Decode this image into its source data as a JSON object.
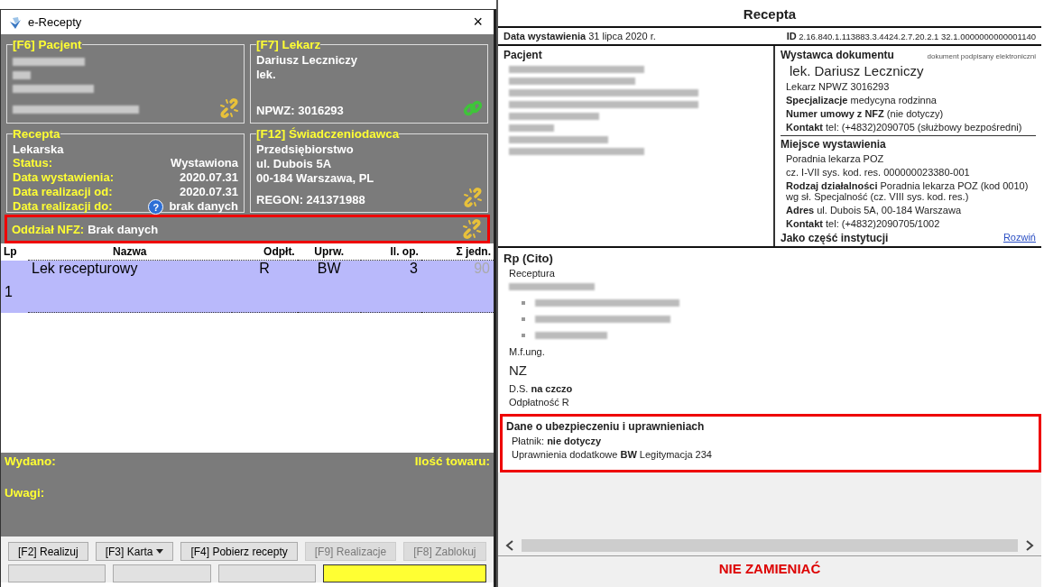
{
  "window": {
    "title": "e-Recepty",
    "close": "×"
  },
  "patient": {
    "legend": "[F6] Pacjent",
    "linked": false
  },
  "doctor": {
    "legend": "[F7] Lekarz",
    "lines": [
      "Dariusz Leczniczy",
      "lek."
    ],
    "npwz": "NPWZ: 3016293",
    "linked": true
  },
  "prescription": {
    "legend": "Recepta",
    "type": "Lekarska",
    "fields": [
      {
        "label": "Status:",
        "value": "Wystawiona"
      },
      {
        "label": "Data wystawienia:",
        "value": "2020.07.31"
      },
      {
        "label": "Data realizacji od:",
        "value": "2020.07.31"
      },
      {
        "label": "Data realizacji do:",
        "value": "brak danych",
        "help": "?"
      }
    ]
  },
  "provider": {
    "legend": "[F12] Świadczeniodawca",
    "lines": [
      "Przedsiębiorstwo",
      "ul. Dubois 5A",
      "00-184 Warszawa, PL"
    ],
    "regon": "REGON: 241371988",
    "linked": false
  },
  "nfz": {
    "label": "Oddział NFZ:",
    "value": "Brak danych",
    "linked": false,
    "highlighted": true
  },
  "table": {
    "columns": [
      "Lp",
      "Nazwa",
      "Odpłt.",
      "Uprw.",
      "Il. op.",
      "Σ jedn."
    ],
    "rows": [
      {
        "cells": [
          "1",
          "Lek recepturowy",
          "R",
          "BW",
          "3",
          "90"
        ],
        "selected": true
      }
    ]
  },
  "summary": {
    "issued_label": "Wydano:",
    "quantity_label": "Ilość towaru:",
    "notes_label": "Uwagi:"
  },
  "buttons": [
    {
      "label": "[F2] Realizuj",
      "disabled": false,
      "dropdown": false
    },
    {
      "label": "[F3] Karta",
      "disabled": false,
      "dropdown": true
    },
    {
      "label": "[F4] Pobierz recepty",
      "disabled": false,
      "dropdown": false
    },
    {
      "label": "[F9] Realizacje",
      "disabled": true,
      "dropdown": false
    },
    {
      "label": "[F8] Zablokuj",
      "disabled": true,
      "dropdown": false
    }
  ],
  "cut_buttons": [
    {
      "highlighted": false
    },
    {
      "highlighted": false
    },
    {
      "highlighted": false
    },
    {
      "highlighted": true
    }
  ],
  "document": {
    "title": "Recepta",
    "date": "**Data wystawienia** 31 lipca 2020 r.",
    "id": "**ID** 2.16.840.1.113883.3.4424.2.7.20.2.1 32.1.0000000000001140",
    "patient_heading": "Pacjent",
    "issuer_heading": "Wystawca dokumentu",
    "signed_note": "dokument podpisany elektroniczni",
    "issuer_name": "lek. Dariusz Leczniczy",
    "issuer_lines": [
      "Lekarz NPWZ 3016293",
      "**Specjalizacje** medycyna rodzinna",
      "**Numer umowy z NFZ** (nie dotyczy)",
      "**Kontakt** tel: (+4832)2090705 (służbowy bezpośredni)"
    ],
    "place_heading": "Miejsce wystawienia",
    "place_lines": [
      "Poradnia lekarza POZ",
      "cz. I-VII sys. kod. res. 000000023380-001",
      "**Rodzaj działalności** Poradnia lekarza POZ (kod 0010) wg sł. Specjalność (cz. VIII sys. kod. res.)",
      "**Adres** ul. Dubois 5A, 00-184 Warszawa",
      "**Kontakt** tel: (+4832)2090705/1002"
    ],
    "institution": "Jako część instytucji",
    "expand_link": "Rozwiń",
    "rp_heading": "Rp (Cito)",
    "rp_type": "Receptura",
    "form": "M.f.ung.",
    "nz": "NZ",
    "dosage": "D.S. **na czczo**",
    "payment": "Odpłatność R",
    "insurance": {
      "heading": "Dane o ubezpieczeniu i uprawnieniach",
      "highlighted": true,
      "lines": [
        "Płatnik: **nie dotyczy**",
        "Uprawnienia dodatkowe **BW** Legitymacja 234"
      ]
    },
    "footer": "NIE ZAMIENIAĆ"
  }
}
